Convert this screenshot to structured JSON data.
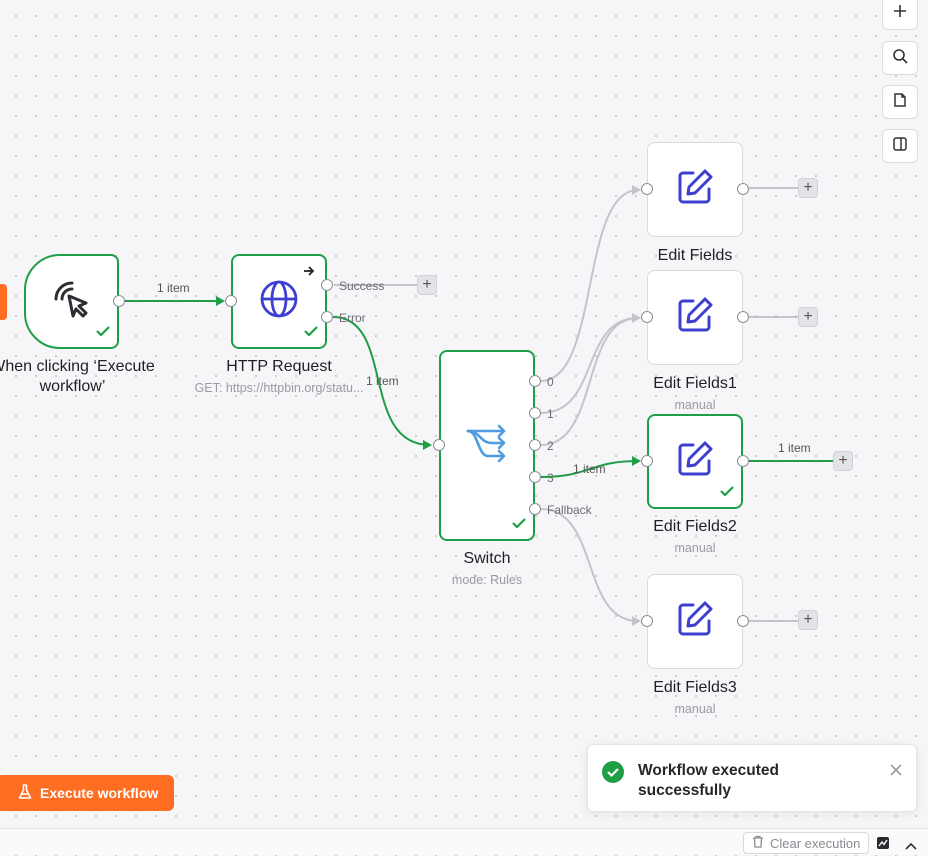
{
  "nodes": {
    "trigger": {
      "label": "When clicking ‘Execute workflow’",
      "status": "success"
    },
    "http": {
      "label": "HTTP Request",
      "subtitle": "GET: https://httpbin.org/statu...",
      "outputs": [
        "Success",
        "Error"
      ],
      "status": "success"
    },
    "switch": {
      "label": "Switch",
      "subtitle": "mode: Rules",
      "outputs": [
        "0",
        "1",
        "2",
        "3",
        "Fallback"
      ],
      "status": "success"
    },
    "edit0": {
      "label": "Edit Fields",
      "subtitle": ""
    },
    "edit1": {
      "label": "Edit Fields1",
      "subtitle": "manual"
    },
    "edit2": {
      "label": "Edit Fields2",
      "subtitle": "manual",
      "status": "success"
    },
    "edit3": {
      "label": "Edit Fields3",
      "subtitle": "manual"
    }
  },
  "edges": {
    "trigger_http": "1 item",
    "error_switch": "1 item",
    "switch3_edit2": "1 item",
    "edit2_out": "1 item"
  },
  "toolbar": {
    "icons": [
      "plus-icon",
      "search-icon",
      "sticky-note-icon",
      "panel-icon"
    ]
  },
  "execute_button": {
    "label": "Execute workflow"
  },
  "toast": {
    "message": "Workflow executed successfully"
  },
  "bottom": {
    "clear_execution": "Clear execution"
  },
  "colors": {
    "accent": "#ff6d22",
    "success": "#1f9e47",
    "edge": "#c4c4ca",
    "node_icon": "#3d3fd1",
    "switch_icon": "#4f9be0"
  }
}
